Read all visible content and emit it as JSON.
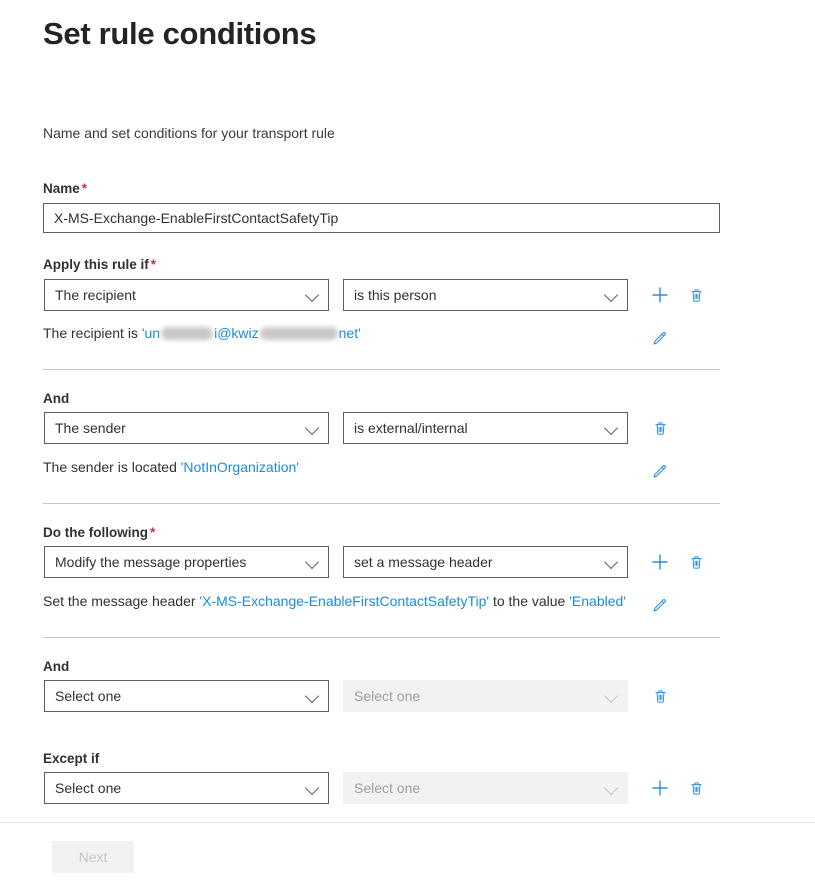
{
  "page": {
    "title": "Set rule conditions",
    "subtitle": "Name and set conditions for your transport rule",
    "accent_blue": "#1a8cdb",
    "required_red": "#c4314b"
  },
  "name_field": {
    "label": "Name",
    "required_marker": "*",
    "value": "X-MS-Exchange-EnableFirstContactSafetyTip",
    "placeholder": ""
  },
  "sections": [
    {
      "label": "Apply this rule if",
      "required_marker": "*",
      "condition": "The recipient",
      "operator": "is this person",
      "disabled_operator": false,
      "has_add": true,
      "has_delete": true,
      "description_prefix": "The recipient is ",
      "description_link": "'un████i@kwiz█████net'",
      "description_redacted": true,
      "has_edit": true,
      "divider_after": true
    },
    {
      "label": "And",
      "required_marker": "",
      "condition": "The sender",
      "operator": "is external/internal",
      "disabled_operator": false,
      "has_add": false,
      "has_delete": true,
      "description_prefix": "The sender is located ",
      "description_link": "'NotInOrganization'",
      "description_redacted": false,
      "has_edit": true,
      "divider_after": true
    },
    {
      "label": "Do the following",
      "required_marker": "*",
      "condition": "Modify the message properties",
      "operator": "set a message header",
      "disabled_operator": false,
      "has_add": true,
      "has_delete": true,
      "description_prefix": "Set the message header  ",
      "description_link": "'X-MS-Exchange-EnableFirstContactSafetyTip'",
      "description_mid": "  to the value  ",
      "description_link2": "'Enabled'",
      "description_redacted": false,
      "has_edit": true,
      "divider_after": true
    },
    {
      "label": "And",
      "required_marker": "",
      "condition": "Select one",
      "operator": "Select one",
      "disabled_operator": true,
      "has_add": false,
      "has_delete": true,
      "description_prefix": "",
      "description_link": "",
      "has_edit": false,
      "divider_after": false
    },
    {
      "label": "Except if",
      "required_marker": "",
      "condition": "Select one",
      "operator": "Select one",
      "disabled_operator": true,
      "has_add": true,
      "has_delete": true,
      "description_prefix": "",
      "description_link": "",
      "has_edit": false,
      "divider_after": false
    }
  ],
  "footer": {
    "next_label": "Next",
    "next_disabled": true
  },
  "icons": {
    "add": "plus-icon",
    "delete": "trash-icon",
    "edit": "pencil-icon",
    "chevron": "chevron-down-icon"
  }
}
